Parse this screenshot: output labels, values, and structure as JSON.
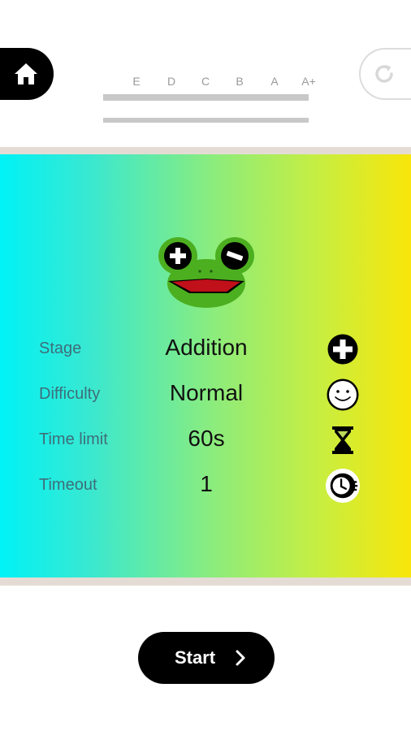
{
  "header": {
    "grades": [
      "E",
      "D",
      "C",
      "B",
      "A",
      "A+"
    ]
  },
  "settings": {
    "stage": {
      "label": "Stage",
      "value": "Addition",
      "icon": "plus-circle-icon"
    },
    "difficulty": {
      "label": "Difficulty",
      "value": "Normal",
      "icon": "smiley-face-icon"
    },
    "time_limit": {
      "label": "Time limit",
      "value": "60s",
      "icon": "hourglass-icon"
    },
    "timeout": {
      "label": "Timeout",
      "value": "1",
      "icon": "clock-icon"
    }
  },
  "footer": {
    "start_label": "Start"
  },
  "colors": {
    "gradient_start": "#00f2f6",
    "gradient_end": "#f8e60a",
    "panel_border": "#e4dcd4",
    "frog_green": "#4caf20",
    "button_black": "#000000"
  }
}
